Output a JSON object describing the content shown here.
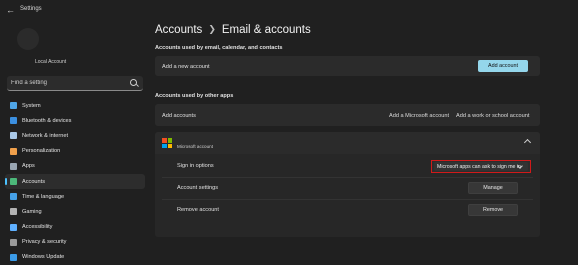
{
  "window": {
    "title": "Settings"
  },
  "sidebar": {
    "account_name": "Local Account",
    "search": {
      "placeholder": "Find a setting"
    },
    "items": [
      {
        "label": "System",
        "icon": "monitor-icon",
        "color": "#4fa6e8"
      },
      {
        "label": "Bluetooth & devices",
        "icon": "bluetooth-icon",
        "color": "#3b8fe0"
      },
      {
        "label": "Network & internet",
        "icon": "wifi-icon",
        "color": "#a8c7e6"
      },
      {
        "label": "Personalization",
        "icon": "brush-icon",
        "color": "#f0a04b"
      },
      {
        "label": "Apps",
        "icon": "apps-icon",
        "color": "#9aa6b2"
      },
      {
        "label": "Accounts",
        "icon": "person-icon",
        "color": "#4cb87a"
      },
      {
        "label": "Time & language",
        "icon": "globe-clock-icon",
        "color": "#45a0e6"
      },
      {
        "label": "Gaming",
        "icon": "controller-icon",
        "color": "#b3b3b3"
      },
      {
        "label": "Accessibility",
        "icon": "accessibility-icon",
        "color": "#5fb0ff"
      },
      {
        "label": "Privacy & security",
        "icon": "shield-icon",
        "color": "#9a9a9a"
      },
      {
        "label": "Windows Update",
        "icon": "update-icon",
        "color": "#3b9be8"
      }
    ],
    "active_index": 5
  },
  "main": {
    "breadcrumb": {
      "parent": "Accounts",
      "current": "Email & accounts"
    },
    "email_section": {
      "heading": "Accounts used by email, calendar, and contacts",
      "add_label": "Add a new account",
      "add_button": "Add account"
    },
    "other_section": {
      "heading": "Accounts used by other apps",
      "add_label": "Add accounts",
      "add_microsoft": "Add a Microsoft account",
      "add_work": "Add a work or school account"
    },
    "ms_account": {
      "title": "Microsoft account",
      "signin_label": "Sign in options",
      "signin_value": "Microsoft apps can ask to sign me in",
      "settings_label": "Account settings",
      "manage_button": "Manage",
      "remove_label": "Remove account",
      "remove_button": "Remove"
    }
  },
  "colors": {
    "accent": "#4cc2ff",
    "accent_button": "#94d6eb",
    "highlight": "#d11a1a",
    "ms_logo": [
      "#f25022",
      "#7fba00",
      "#00a4ef",
      "#ffb900"
    ]
  }
}
